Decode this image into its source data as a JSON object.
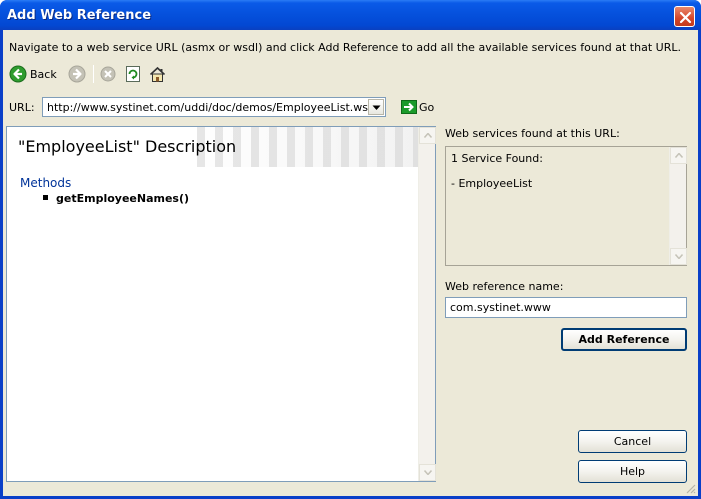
{
  "window": {
    "title": "Add Web Reference"
  },
  "instructions": "Navigate to a web service URL (asmx or wsdl) and click Add Reference to add all the available services found at that URL.",
  "toolbar": {
    "back_label": "Back",
    "icons": [
      "back-icon",
      "forward-icon",
      "stop-icon",
      "refresh-icon",
      "home-icon"
    ]
  },
  "url": {
    "label": "URL:",
    "value": "http://www.systinet.com/uddi/doc/demos/EmployeeList.wsdl",
    "go_label": "Go"
  },
  "description": {
    "title": "\"EmployeeList\" Description",
    "methods_label": "Methods",
    "methods": [
      "getEmployeeNames()"
    ]
  },
  "services": {
    "label": "Web services found at this URL:",
    "count_text": "1 Service Found:",
    "items": [
      "- EmployeeList"
    ]
  },
  "reference_name": {
    "label": "Web reference name:",
    "value": "com.systinet.www"
  },
  "buttons": {
    "add_reference": "Add Reference",
    "cancel": "Cancel",
    "help": "Help"
  },
  "colors": {
    "titlebar": "#0550dc",
    "dialog_bg": "#ece9d8",
    "close_button": "#d5462a",
    "methods_link": "#003399",
    "go_arrow": "#1a9a2a"
  }
}
